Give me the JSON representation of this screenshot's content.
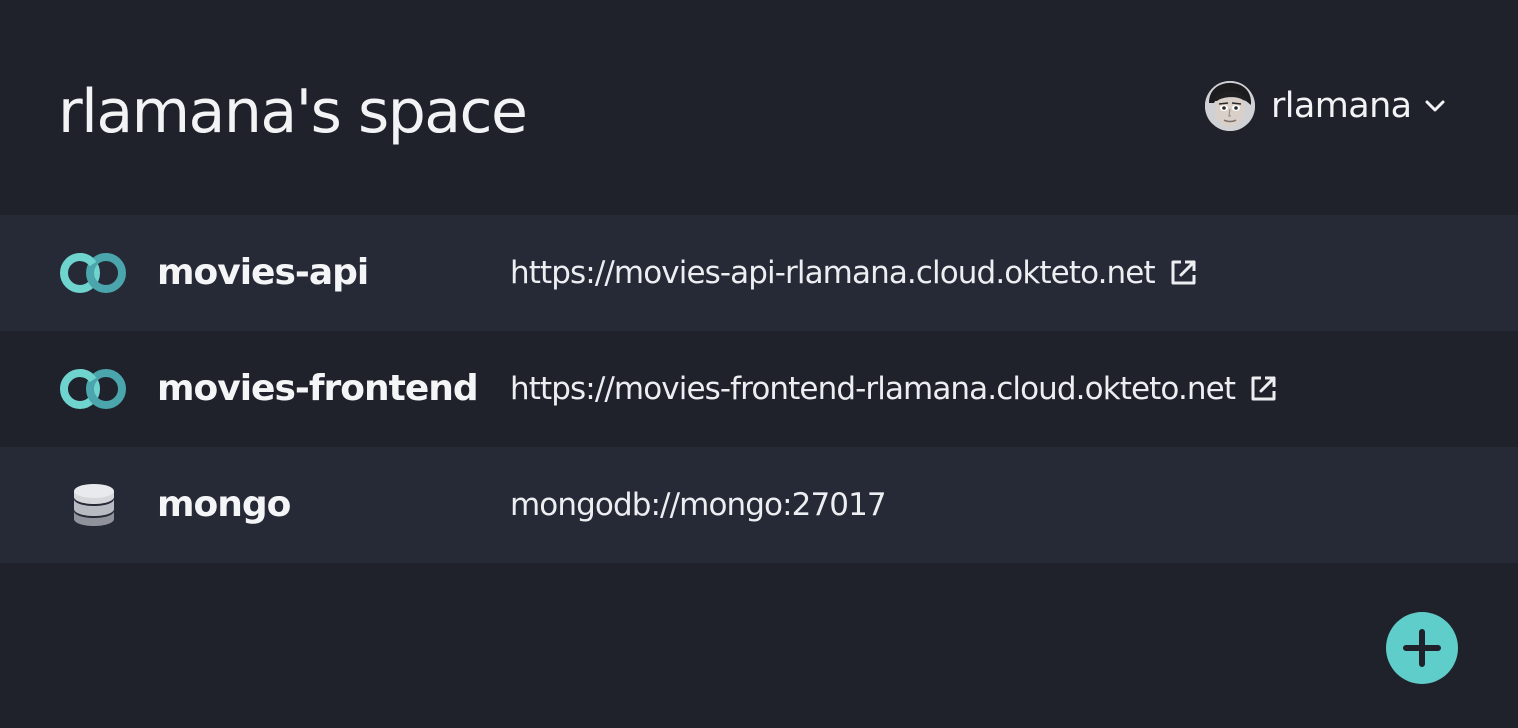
{
  "space": {
    "title": "rlamana's space"
  },
  "user": {
    "name": "rlamana",
    "avatar_icon": "user-avatar",
    "menu_icon": "chevron-down-icon"
  },
  "colors": {
    "background": "#1f222b",
    "row_alt": "#262a36",
    "accent": "#5fcdc9",
    "text": "#f2f3f5"
  },
  "services": [
    {
      "name": "movies-api",
      "type_icon": "okteto-service-icon",
      "endpoint": "https://movies-api-rlamana.cloud.okteto.net",
      "external_icon": "external-link-icon"
    },
    {
      "name": "movies-frontend",
      "type_icon": "okteto-service-icon",
      "endpoint": "https://movies-frontend-rlamana.cloud.okteto.net",
      "external_icon": "external-link-icon"
    },
    {
      "name": "mongo",
      "type_icon": "database-icon",
      "endpoint": "mongodb://mongo:27017"
    }
  ],
  "actions": {
    "add_icon": "plus-icon"
  }
}
